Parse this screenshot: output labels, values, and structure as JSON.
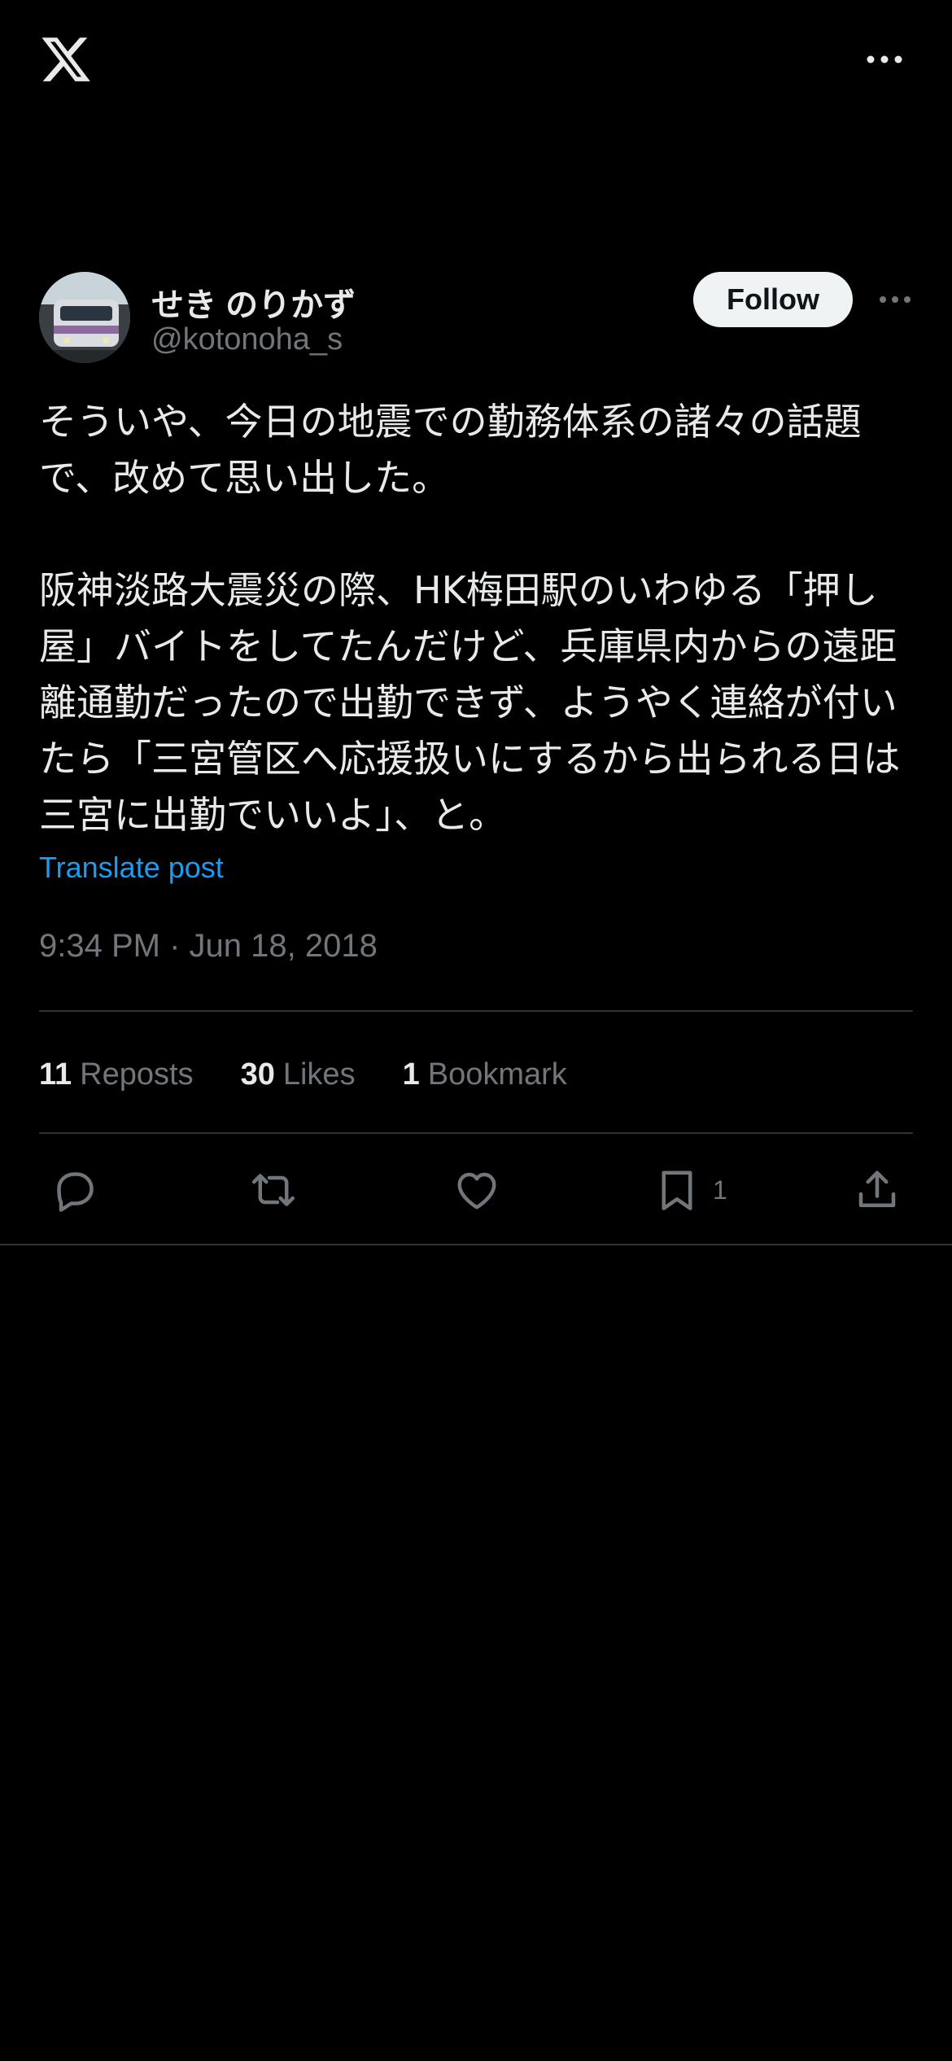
{
  "post": {
    "display_name": "せき のりかず",
    "handle": "@kotonoha_s",
    "follow_label": "Follow",
    "text": "そういや、今日の地震での勤務体系の諸々の話題で、改めて思い出した。\n\n阪神淡路大震災の際、HK梅田駅のいわゆる「押し屋」バイトをしてたんだけど、兵庫県内からの遠距離通勤だったので出勤できず、ようやく連絡が付いたら「三宮管区へ応援扱いにするから出られる日は三宮に出勤でいいよ」、と。",
    "translate_label": "Translate post",
    "timestamp": "9:34 PM · Jun 18, 2018"
  },
  "stats": {
    "reposts_count": "11",
    "reposts_label": "Reposts",
    "likes_count": "30",
    "likes_label": "Likes",
    "bookmarks_count": "1",
    "bookmarks_label": "Bookmark"
  },
  "actions": {
    "bookmark_count": "1"
  },
  "icons": {
    "logo": "x-logo-icon",
    "more": "more-horizontal-icon",
    "reply": "reply-icon",
    "repost": "repost-icon",
    "like": "heart-icon",
    "bookmark": "bookmark-icon",
    "share": "share-icon"
  },
  "colors": {
    "background": "#000000",
    "text": "#e7e9ea",
    "secondary": "#71767b",
    "link": "#1d9bf0",
    "divider": "#2f3336"
  }
}
